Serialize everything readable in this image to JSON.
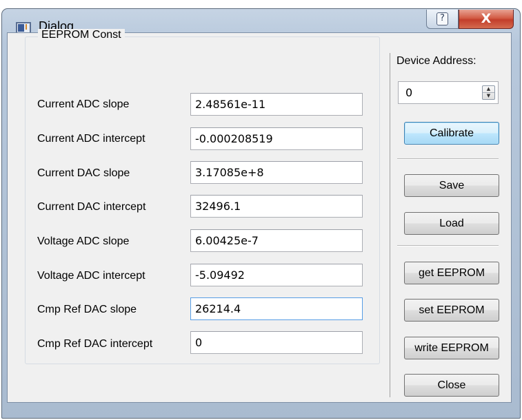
{
  "window": {
    "title": "Dialog",
    "help_glyph": "?",
    "close_glyph": "X"
  },
  "eeprom": {
    "group_title": "EEPROM Const",
    "fields": [
      {
        "label": "Current ADC slope",
        "value": "2.48561e-11"
      },
      {
        "label": "Current ADC intercept",
        "value": "-0.000208519"
      },
      {
        "label": "Current DAC slope",
        "value": "3.17085e+8"
      },
      {
        "label": "Current DAC intercept",
        "value": "32496.1"
      },
      {
        "label": "Voltage ADC slope",
        "value": "6.00425e-7"
      },
      {
        "label": "Voltage ADC intercept",
        "value": "-5.09492"
      },
      {
        "label": "Cmp Ref DAC slope",
        "value": "26214.4"
      },
      {
        "label": "Cmp Ref DAC intercept",
        "value": "0"
      }
    ]
  },
  "device": {
    "label": "Device Address:",
    "value": "0"
  },
  "buttons": {
    "calibrate": "Calibrate",
    "save": "Save",
    "load": "Load",
    "get_eeprom": "get EEPROM",
    "set_eeprom": "set EEPROM",
    "write_eeprom": "write EEPROM",
    "close": "Close"
  },
  "icons": {
    "title": "dialog-app-icon",
    "spin_up": "arrow-up-icon",
    "spin_down": "arrow-down-icon"
  }
}
